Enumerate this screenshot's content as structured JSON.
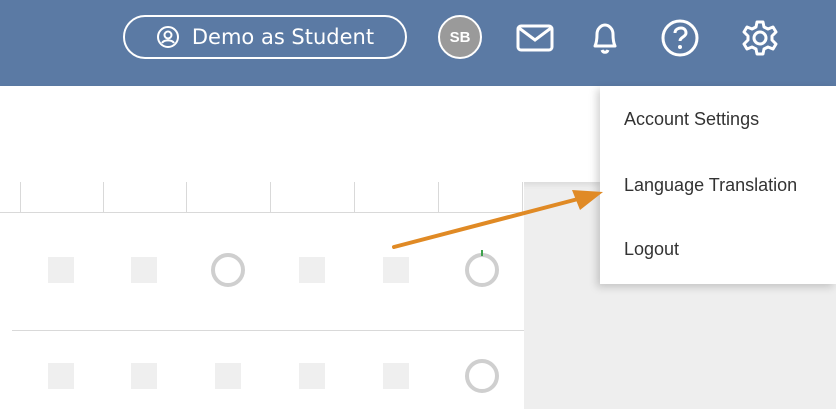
{
  "header": {
    "demo_button_label": "Demo as Student",
    "avatar_initials": "SB",
    "color": "#5b7aa4"
  },
  "menu": {
    "items": [
      {
        "label": "Account Settings"
      },
      {
        "label": "Language Translation"
      },
      {
        "label": "Logout"
      }
    ]
  },
  "icons": [
    "user-circle-icon",
    "mail-icon",
    "bell-icon",
    "help-icon",
    "gear-icon"
  ],
  "annotation": {
    "color": "#e08a25"
  }
}
